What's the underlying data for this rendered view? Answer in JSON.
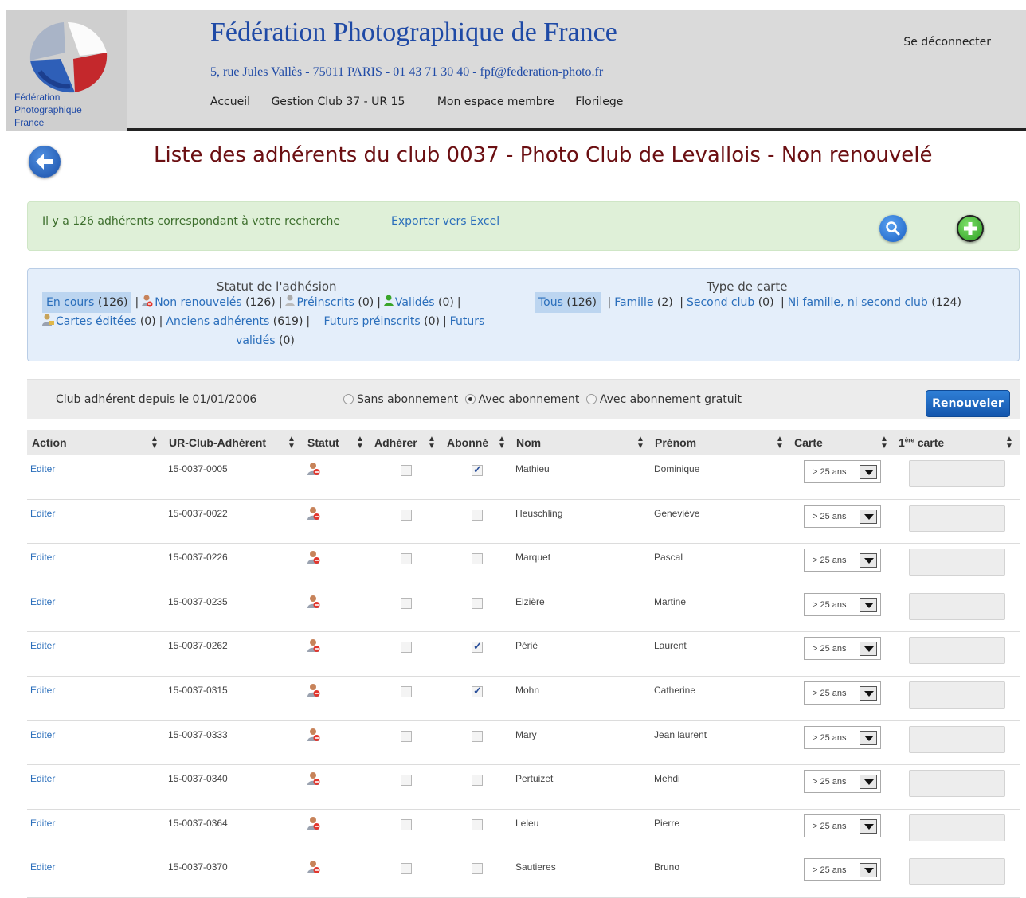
{
  "header": {
    "logo_text": [
      "Fédération",
      "Photographique",
      "France"
    ],
    "title": "Fédération Photographique de France",
    "address": "5, rue Jules Vallès - 75011 PARIS - 01 43 71 30 40 - fpf@federation-photo.fr",
    "nav": [
      "Accueil",
      "Gestion Club 37 - UR 15",
      "Mon espace membre",
      "Florilege"
    ],
    "logout": "Se déconnecter"
  },
  "page": {
    "title": "Liste des adhérents du club 0037 - Photo Club de Levallois - Non renouvelé"
  },
  "results": {
    "text": "Il y a 126 adhérents correspondant à votre recherche",
    "export": "Exporter vers Excel"
  },
  "filters": {
    "statut_title": "Statut de l'adhésion",
    "type_title": "Type de carte",
    "en_cours": "En cours",
    "en_cours_count": "(126)",
    "non_renouveles": "Non renouvelés",
    "non_renouveles_count": "(126)",
    "preinscrits": "Préinscrits",
    "preinscrits_count": "(0)",
    "valides": "Validés",
    "valides_count": "(0)",
    "cartes_editees": "Cartes éditées",
    "cartes_editees_count": "(0)",
    "anciens": "Anciens adhérents",
    "anciens_count": "(619)",
    "futurs_preinscrits": "Futurs préinscrits",
    "futurs_preinscrits_count": "(0)",
    "futurs_valides_1": "Futurs",
    "futurs_valides_2": "validés",
    "futurs_valides_count": "(0)",
    "tous": "Tous",
    "tous_count": "(126)",
    "famille": "Famille",
    "famille_count": "(2)",
    "second_club": "Second club",
    "second_club_count": "(0)",
    "ni_famille": "Ni famille, ni second club",
    "ni_famille_count": "(124)"
  },
  "options": {
    "club_since": "Club adhérent depuis le 01/01/2006",
    "radios": [
      "Sans abonnement",
      "Avec abonnement",
      "Avec abonnement gratuit"
    ],
    "selected_radio": "Avec abonnement",
    "renew_button": "Renouveler"
  },
  "table": {
    "columns": [
      "Action",
      "UR-Club-Adhérent",
      "Statut",
      "Adhérer",
      "Abonné",
      "Nom",
      "Prénom",
      "Carte",
      "1ère carte"
    ],
    "first_card_sup": "ère",
    "first_card_num": "1",
    "first_card_word": "carte",
    "rows": [
      {
        "action": "Editer",
        "id": "15-0037-0005",
        "adherer": false,
        "abonne": true,
        "nom": "Mathieu",
        "prenom": "Dominique",
        "carte": "> 25 ans"
      },
      {
        "action": "Editer",
        "id": "15-0037-0022",
        "adherer": false,
        "abonne": false,
        "nom": "Heuschling",
        "prenom": "Geneviève",
        "carte": "> 25 ans"
      },
      {
        "action": "Editer",
        "id": "15-0037-0226",
        "adherer": false,
        "abonne": false,
        "nom": "Marquet",
        "prenom": "Pascal",
        "carte": "> 25 ans"
      },
      {
        "action": "Editer",
        "id": "15-0037-0235",
        "adherer": false,
        "abonne": false,
        "nom": "Elzière",
        "prenom": "Martine",
        "carte": "> 25 ans"
      },
      {
        "action": "Editer",
        "id": "15-0037-0262",
        "adherer": false,
        "abonne": true,
        "nom": "Périé",
        "prenom": "Laurent",
        "carte": "> 25 ans"
      },
      {
        "action": "Editer",
        "id": "15-0037-0315",
        "adherer": false,
        "abonne": true,
        "nom": "Mohn",
        "prenom": "Catherine",
        "carte": "> 25 ans"
      },
      {
        "action": "Editer",
        "id": "15-0037-0333",
        "adherer": false,
        "abonne": false,
        "nom": "Mary",
        "prenom": "Jean laurent",
        "carte": "> 25 ans"
      },
      {
        "action": "Editer",
        "id": "15-0037-0340",
        "adherer": false,
        "abonne": false,
        "nom": "Pertuizet",
        "prenom": "Mehdi",
        "carte": "> 25 ans"
      },
      {
        "action": "Editer",
        "id": "15-0037-0364",
        "adherer": false,
        "abonne": false,
        "nom": "Leleu",
        "prenom": "Pierre",
        "carte": "> 25 ans"
      },
      {
        "action": "Editer",
        "id": "15-0037-0370",
        "adherer": false,
        "abonne": false,
        "nom": "Sautieres",
        "prenom": "Bruno",
        "carte": "> 25 ans"
      }
    ]
  },
  "icons": {
    "back": "arrow-left-icon",
    "search": "search-icon",
    "add": "plus-icon",
    "status": "user-remove-icon"
  },
  "colors": {
    "brand_blue": "#1f4aa6",
    "title_red": "#6b0f12",
    "link": "#2a6ebb",
    "success_bg": "#dff0d8",
    "filter_bg": "#e4eefa",
    "button_blue": "#1456ad"
  }
}
